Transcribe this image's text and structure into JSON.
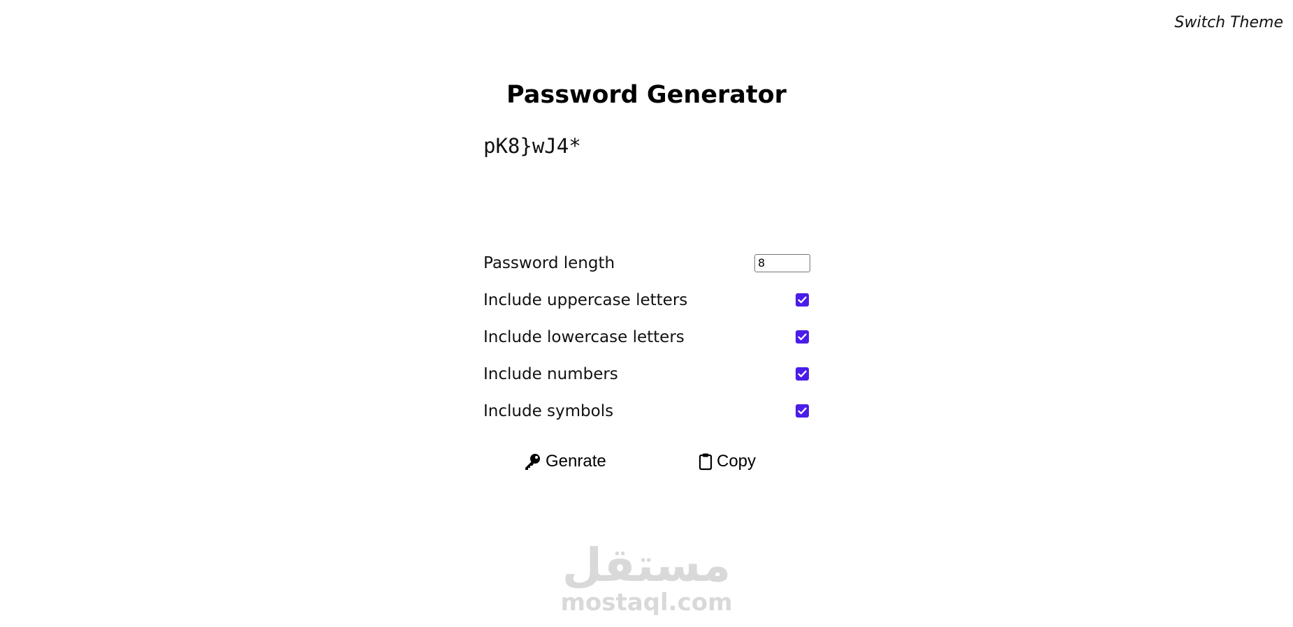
{
  "header": {
    "switch_theme_label": "Switch Theme"
  },
  "app": {
    "title": "Password Generator",
    "generated_password": "pK8}wJ4*"
  },
  "options": {
    "length": {
      "label": "Password length",
      "value": "8"
    },
    "uppercase": {
      "label": "Include uppercase letters",
      "checked": true
    },
    "lowercase": {
      "label": "Include lowercase letters",
      "checked": true
    },
    "numbers": {
      "label": "Include numbers",
      "checked": true
    },
    "symbols": {
      "label": "Include symbols",
      "checked": true
    },
    "checkbox_color": "#4a1de8"
  },
  "actions": {
    "generate": {
      "label": "Genrate",
      "icon": "key-icon"
    },
    "copy": {
      "label": "Copy",
      "icon": "clipboard-icon"
    }
  },
  "watermark": {
    "arabic_text": "مستقل",
    "latin_text": "mostaql.com"
  }
}
